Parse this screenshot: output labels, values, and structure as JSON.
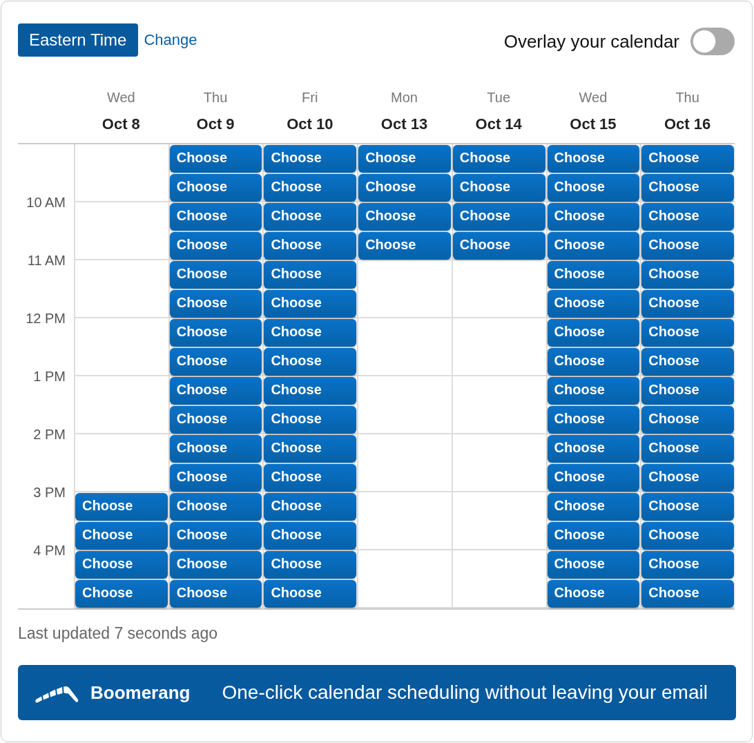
{
  "timezone": {
    "label": "Eastern Time",
    "action": "Change"
  },
  "overlay": {
    "label": "Overlay your calendar",
    "on": false
  },
  "time_labels": [
    "10 AM",
    "11 AM",
    "12 PM",
    "1 PM",
    "2 PM",
    "3 PM",
    "4 PM"
  ],
  "days": [
    {
      "weekday": "Wed",
      "date": "Oct 8",
      "slots": [
        {
          "available": false
        },
        {
          "available": false
        },
        {
          "available": false
        },
        {
          "available": false
        },
        {
          "available": false
        },
        {
          "available": false
        },
        {
          "available": false
        },
        {
          "available": false
        },
        {
          "available": false
        },
        {
          "available": false
        },
        {
          "available": false
        },
        {
          "available": false
        },
        {
          "available": true,
          "label": "Choose"
        },
        {
          "available": true,
          "label": "Choose"
        },
        {
          "available": true,
          "label": "Choose"
        },
        {
          "available": true,
          "label": "Choose"
        }
      ]
    },
    {
      "weekday": "Thu",
      "date": "Oct 9",
      "slots": [
        {
          "available": true,
          "label": "Choose"
        },
        {
          "available": true,
          "label": "Choose"
        },
        {
          "available": true,
          "label": "Choose"
        },
        {
          "available": true,
          "label": "Choose"
        },
        {
          "available": true,
          "label": "Choose"
        },
        {
          "available": true,
          "label": "Choose"
        },
        {
          "available": true,
          "label": "Choose"
        },
        {
          "available": true,
          "label": "Choose"
        },
        {
          "available": true,
          "label": "Choose"
        },
        {
          "available": true,
          "label": "Choose"
        },
        {
          "available": true,
          "label": "Choose"
        },
        {
          "available": true,
          "label": "Choose"
        },
        {
          "available": true,
          "label": "Choose"
        },
        {
          "available": true,
          "label": "Choose"
        },
        {
          "available": true,
          "label": "Choose"
        },
        {
          "available": true,
          "label": "Choose"
        }
      ]
    },
    {
      "weekday": "Fri",
      "date": "Oct 10",
      "slots": [
        {
          "available": true,
          "label": "Choose"
        },
        {
          "available": true,
          "label": "Choose"
        },
        {
          "available": true,
          "label": "Choose"
        },
        {
          "available": true,
          "label": "Choose"
        },
        {
          "available": true,
          "label": "Choose"
        },
        {
          "available": true,
          "label": "Choose"
        },
        {
          "available": true,
          "label": "Choose"
        },
        {
          "available": true,
          "label": "Choose"
        },
        {
          "available": true,
          "label": "Choose"
        },
        {
          "available": true,
          "label": "Choose"
        },
        {
          "available": true,
          "label": "Choose"
        },
        {
          "available": true,
          "label": "Choose"
        },
        {
          "available": true,
          "label": "Choose"
        },
        {
          "available": true,
          "label": "Choose"
        },
        {
          "available": true,
          "label": "Choose"
        },
        {
          "available": true,
          "label": "Choose"
        }
      ]
    },
    {
      "weekday": "Mon",
      "date": "Oct 13",
      "slots": [
        {
          "available": true,
          "label": "Choose"
        },
        {
          "available": true,
          "label": "Choose"
        },
        {
          "available": true,
          "label": "Choose"
        },
        {
          "available": true,
          "label": "Choose"
        },
        {
          "available": false
        },
        {
          "available": false
        },
        {
          "available": false
        },
        {
          "available": false
        },
        {
          "available": false
        },
        {
          "available": false
        },
        {
          "available": false
        },
        {
          "available": false
        },
        {
          "available": false
        },
        {
          "available": false
        },
        {
          "available": false
        },
        {
          "available": false
        }
      ]
    },
    {
      "weekday": "Tue",
      "date": "Oct 14",
      "slots": [
        {
          "available": true,
          "label": "Choose"
        },
        {
          "available": true,
          "label": "Choose"
        },
        {
          "available": true,
          "label": "Choose"
        },
        {
          "available": true,
          "label": "Choose"
        },
        {
          "available": false
        },
        {
          "available": false
        },
        {
          "available": false
        },
        {
          "available": false
        },
        {
          "available": false
        },
        {
          "available": false
        },
        {
          "available": false
        },
        {
          "available": false
        },
        {
          "available": false
        },
        {
          "available": false
        },
        {
          "available": false
        },
        {
          "available": false
        }
      ]
    },
    {
      "weekday": "Wed",
      "date": "Oct 15",
      "slots": [
        {
          "available": true,
          "label": "Choose"
        },
        {
          "available": true,
          "label": "Choose"
        },
        {
          "available": true,
          "label": "Choose"
        },
        {
          "available": true,
          "label": "Choose"
        },
        {
          "available": true,
          "label": "Choose"
        },
        {
          "available": true,
          "label": "Choose"
        },
        {
          "available": true,
          "label": "Choose"
        },
        {
          "available": true,
          "label": "Choose"
        },
        {
          "available": true,
          "label": "Choose"
        },
        {
          "available": true,
          "label": "Choose"
        },
        {
          "available": true,
          "label": "Choose"
        },
        {
          "available": true,
          "label": "Choose"
        },
        {
          "available": true,
          "label": "Choose"
        },
        {
          "available": true,
          "label": "Choose"
        },
        {
          "available": true,
          "label": "Choose"
        },
        {
          "available": true,
          "label": "Choose"
        }
      ]
    },
    {
      "weekday": "Thu",
      "date": "Oct 16",
      "slots": [
        {
          "available": true,
          "label": "Choose"
        },
        {
          "available": true,
          "label": "Choose"
        },
        {
          "available": true,
          "label": "Choose"
        },
        {
          "available": true,
          "label": "Choose"
        },
        {
          "available": true,
          "label": "Choose"
        },
        {
          "available": true,
          "label": "Choose"
        },
        {
          "available": true,
          "label": "Choose"
        },
        {
          "available": true,
          "label": "Choose"
        },
        {
          "available": true,
          "label": "Choose"
        },
        {
          "available": true,
          "label": "Choose"
        },
        {
          "available": true,
          "label": "Choose"
        },
        {
          "available": true,
          "label": "Choose"
        },
        {
          "available": true,
          "label": "Choose"
        },
        {
          "available": true,
          "label": "Choose"
        },
        {
          "available": true,
          "label": "Choose"
        },
        {
          "available": true,
          "label": "Choose"
        }
      ]
    }
  ],
  "status": "Last updated 7 seconds ago",
  "banner": {
    "brand": "Boomerang",
    "tagline": "One-click calendar scheduling without leaving your email"
  }
}
